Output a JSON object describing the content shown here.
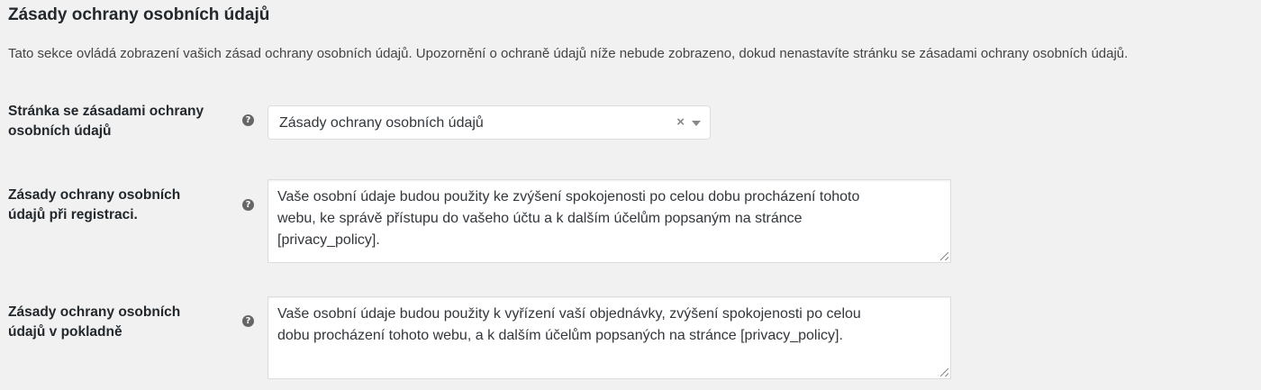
{
  "section": {
    "title": "Zásady ochrany osobních údajů",
    "description": "Tato sekce ovládá zobrazení vašich zásad ochrany osobních údajů. Upozornění o ochraně údajů níže nebude zobrazeno, dokud nenastavíte stránku se zásadami ochrany osobních údajů."
  },
  "fields": [
    {
      "label_line1": "Stránka se zásadami ochrany",
      "label_line2": "osobních údajů",
      "help_icon": "question-circle-icon",
      "selected_value": "Zásady ochrany osobních údajů",
      "clear_glyph": "×"
    },
    {
      "label_line1": "Zásady ochrany osobních",
      "label_line2": "údajů při registraci.",
      "help_icon": "question-circle-icon",
      "value": "Vaše osobní údaje budou použity ke zvýšení spokojenosti po celou dobu procházení tohoto\nwebu, ke správě přístupu do vašeho účtu a k dalším účelům popsaným na stránce\n[privacy_policy]."
    },
    {
      "label_line1": "Zásady ochrany osobních",
      "label_line2": "údajů v pokladně",
      "help_icon": "question-circle-icon",
      "value": "Vaše osobní údaje budou použity k vyřízení vaší objednávky, zvýšení spokojenosti po celou\ndobu procházení tohoto webu, a k dalším účelům popsaných na stránce [privacy_policy]."
    }
  ],
  "help_glyph": "?",
  "colors": {
    "background": "#f1f1f1",
    "text": "#23282d",
    "field_bg": "#ffffff",
    "border": "#dddddd"
  }
}
